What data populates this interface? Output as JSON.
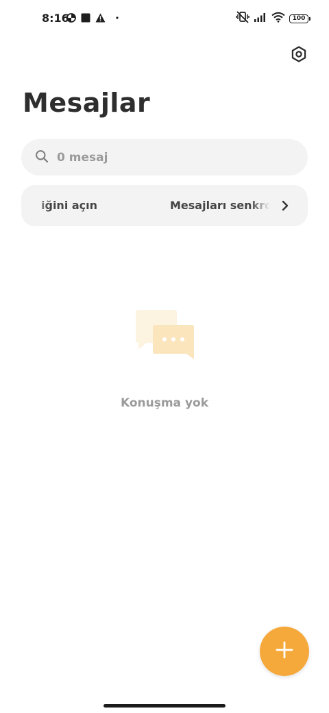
{
  "status_bar": {
    "time": "8:16",
    "battery": "100"
  },
  "header": {
    "title": "Mesajlar"
  },
  "search": {
    "placeholder": "0 mesaj"
  },
  "sync_banner": {
    "text_part1": "iğini açın",
    "text_part2": "Mesajları senkro"
  },
  "empty_state": {
    "message": "Konuşma yok"
  },
  "colors": {
    "accent": "#f6a93b",
    "surface": "#f3f3f3",
    "illustration_back": "#fdf3e1",
    "illustration_front": "#fbe5bd"
  },
  "icons": {
    "settings": "settings-hexagon-icon",
    "search": "search-icon",
    "chevron": "chevron-right-icon",
    "fab": "plus-icon"
  }
}
